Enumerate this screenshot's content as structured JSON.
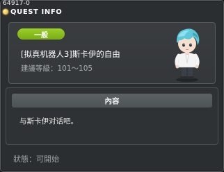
{
  "window": {
    "quest_id": "64917-0",
    "title": "QUEST INFO"
  },
  "quest": {
    "category": "一般",
    "name": "[拟真机器人3]斯卡伊的自由",
    "level_requirement": "建議等級：101～105"
  },
  "content": {
    "header": "內容",
    "description": "与斯卡伊对话吧。"
  },
  "status": {
    "text": "狀態：可開始"
  },
  "colors": {
    "background": "#2b2e30",
    "category_badge": "#8cc21f",
    "content_header": "#555b5d",
    "title_text": "#ffffff",
    "secondary_text": "#a9adaf"
  },
  "icons": {
    "title_icon": "lightbulb-icon",
    "npc_portrait": "npc-portrait"
  }
}
